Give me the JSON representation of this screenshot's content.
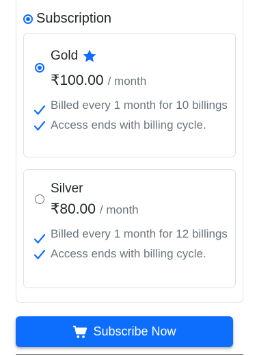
{
  "section": {
    "title": "Subscription",
    "selected": true
  },
  "plans": [
    {
      "name": "Gold",
      "icon": "star-icon",
      "selected": true,
      "price": "₹100.00",
      "period": "/ month",
      "features": [
        "Billed every 1 month for 10 billings",
        "Access ends with billing cycle."
      ]
    },
    {
      "name": "Silver",
      "selected": false,
      "price": "₹80.00",
      "period": "/ month",
      "features": [
        "Billed every 1 month for 12 billings",
        "Access ends with billing cycle."
      ]
    }
  ],
  "button": {
    "label": "Subscribe Now",
    "icon": "cart-icon"
  },
  "colors": {
    "accent": "#0d6efd",
    "muted_text": "#6c757d",
    "border": "#dee2e6"
  }
}
